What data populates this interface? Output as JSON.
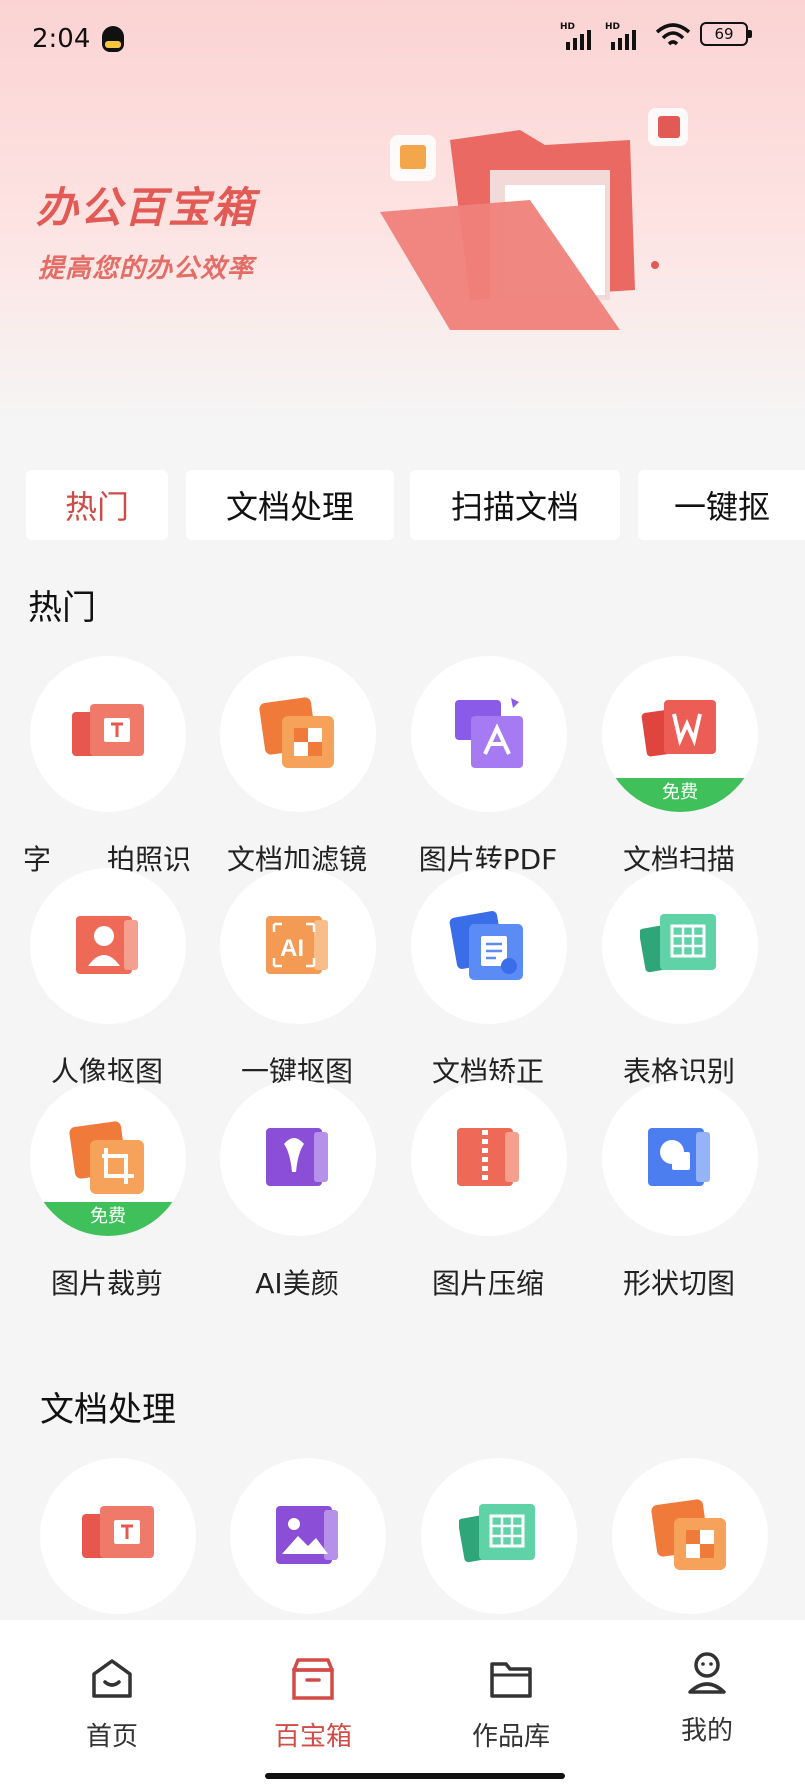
{
  "status_bar": {
    "time": "2:04",
    "battery": "69",
    "network_labels": [
      "HD",
      "HD"
    ]
  },
  "hero": {
    "title": "办公百宝箱",
    "subtitle": "提高您的办公效率"
  },
  "tabs": [
    {
      "label": "热门",
      "active": true
    },
    {
      "label": "文档处理",
      "active": false
    },
    {
      "label": "扫描文档",
      "active": false
    },
    {
      "label": "一键抠",
      "active": false
    }
  ],
  "sections": {
    "hot": {
      "title": "热门",
      "items": [
        {
          "label": "字　　拍照识",
          "icon": "text-recognition-icon",
          "badge": ""
        },
        {
          "label": "文档加滤镜",
          "icon": "filter-icon",
          "badge": ""
        },
        {
          "label": "图片转PDF",
          "icon": "pdf-icon",
          "badge": ""
        },
        {
          "label": "文档扫描",
          "icon": "word-scan-icon",
          "badge": "免费"
        },
        {
          "label": "人像抠图",
          "icon": "portrait-cutout-icon",
          "badge": ""
        },
        {
          "label": "一键抠图",
          "icon": "ai-cutout-icon",
          "badge": ""
        },
        {
          "label": "文档矫正",
          "icon": "document-correct-icon",
          "badge": ""
        },
        {
          "label": "表格识别",
          "icon": "table-recognition-icon",
          "badge": ""
        },
        {
          "label": "图片裁剪",
          "icon": "crop-icon",
          "badge": "免费"
        },
        {
          "label": "AI美颜",
          "icon": "beauty-icon",
          "badge": ""
        },
        {
          "label": "图片压缩",
          "icon": "compress-icon",
          "badge": ""
        },
        {
          "label": "形状切图",
          "icon": "shape-cut-icon",
          "badge": ""
        }
      ]
    },
    "doc": {
      "title": "文档处理",
      "items": [
        {
          "label": "",
          "icon": "text-recognition-icon"
        },
        {
          "label": "",
          "icon": "image-icon"
        },
        {
          "label": "",
          "icon": "table-recognition-icon"
        },
        {
          "label": "",
          "icon": "filter-icon"
        }
      ]
    }
  },
  "bottom_nav": [
    {
      "label": "首页",
      "icon": "home-icon",
      "active": false
    },
    {
      "label": "百宝箱",
      "icon": "toolbox-icon",
      "active": true
    },
    {
      "label": "作品库",
      "icon": "folder-icon",
      "active": false
    },
    {
      "label": "我的",
      "icon": "profile-icon",
      "active": false
    }
  ],
  "colors": {
    "accent": "#d24c47",
    "free_badge": "#3fc05a",
    "page_bg": "#f5f5f5"
  }
}
